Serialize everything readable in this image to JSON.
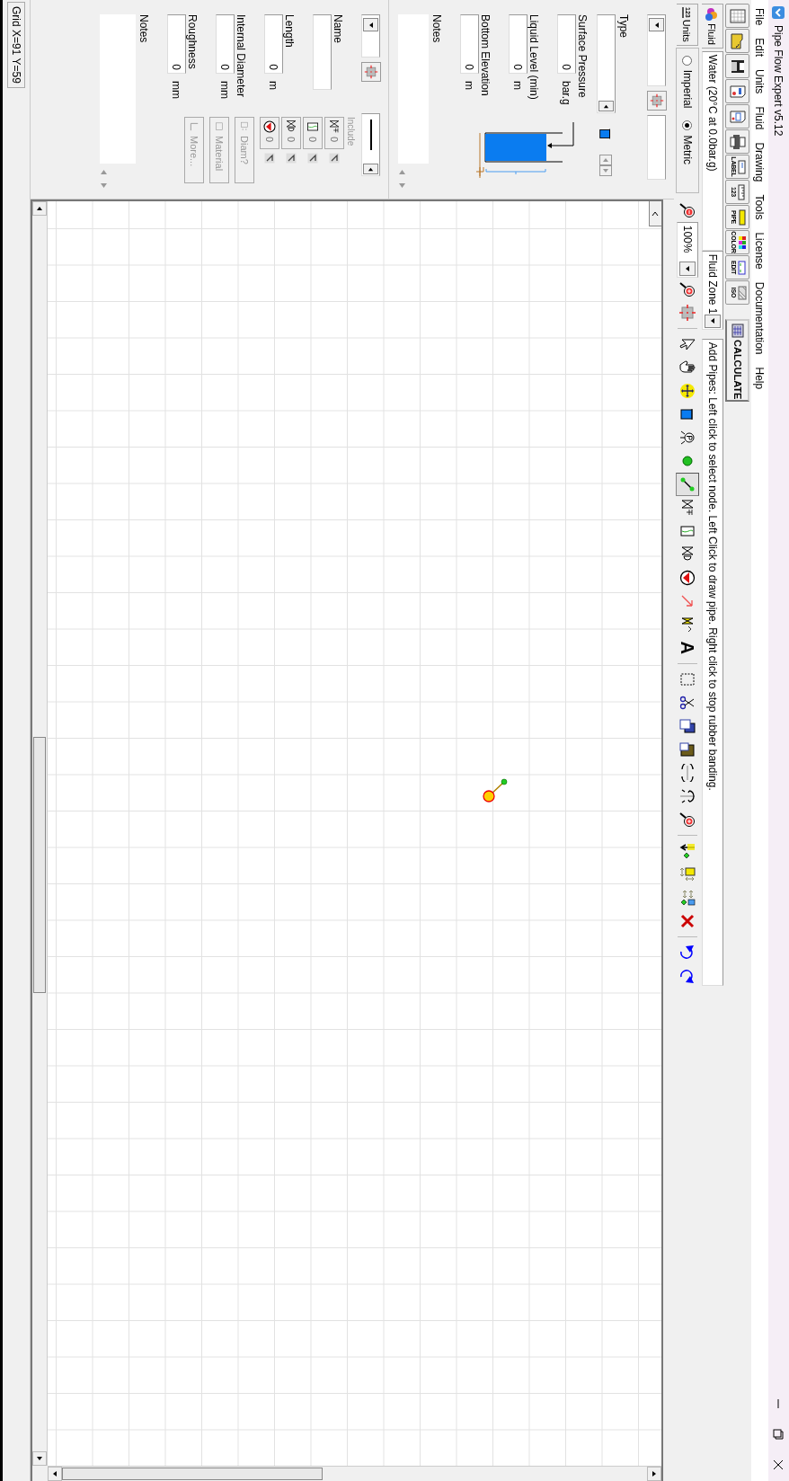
{
  "window": {
    "title": "Pipe Flow Expert v5.12"
  },
  "menu": [
    "File",
    "Edit",
    "Units",
    "Fluid",
    "Drawing",
    "Tools",
    "License",
    "Documentation",
    "Help"
  ],
  "file_toolbar": [
    {
      "kind": "new"
    },
    {
      "kind": "open"
    },
    {
      "kind": "save"
    },
    {
      "kind": "report"
    },
    {
      "kind": "preview"
    },
    {
      "kind": "print"
    },
    {
      "kind": "label",
      "label": "LABEL"
    },
    {
      "kind": "units",
      "label": "123"
    },
    {
      "kind": "pipe_db",
      "label": "PIPE"
    },
    {
      "kind": "color",
      "label": "COLOR"
    },
    {
      "kind": "edit",
      "label": "EDIT"
    },
    {
      "kind": "iso",
      "label": "ISO"
    }
  ],
  "calculate_button": "CALCULATE",
  "fluid": {
    "tab": "Fluid",
    "value": "Water (20°C at 0.0bar.g)"
  },
  "fluid_zone": {
    "value": "Fluid Zone 1"
  },
  "status_hint": "Add Pipes: Left click to select node. Left Click to draw pipe. Right click to stop rubber banding.",
  "units": {
    "tab_icon_text": "123",
    "tab": "Units",
    "options": [
      {
        "label": "Imperial",
        "selected": false
      },
      {
        "label": "Metric",
        "selected": true
      }
    ]
  },
  "zoom": {
    "value": "100%"
  },
  "tool_groups": [
    [
      {
        "kind": "pointer",
        "selected": false
      },
      {
        "kind": "hand",
        "selected": false
      },
      {
        "kind": "move",
        "selected": false
      },
      {
        "kind": "tank",
        "selected": false
      },
      {
        "kind": "gauge",
        "selected": false
      },
      {
        "kind": "node",
        "selected": false
      },
      {
        "kind": "pipe",
        "selected": true
      },
      {
        "kind": "valve",
        "selected": false
      },
      {
        "kind": "component",
        "selected": false
      },
      {
        "kind": "control_valve",
        "selected": false
      },
      {
        "kind": "pump",
        "selected": false
      },
      {
        "kind": "arrow_line",
        "selected": false
      },
      {
        "kind": "flow",
        "selected": false
      },
      {
        "kind": "text",
        "label": "A",
        "selected": false
      }
    ],
    [
      {
        "kind": "select"
      },
      {
        "kind": "cut"
      },
      {
        "kind": "copy"
      },
      {
        "kind": "paste"
      },
      {
        "kind": "flip_h"
      },
      {
        "kind": "flip_v"
      },
      {
        "kind": "zoom_area"
      }
    ],
    [
      {
        "kind": "insert_node"
      },
      {
        "kind": "resize"
      },
      {
        "kind": "shift"
      },
      {
        "kind": "delete"
      }
    ],
    [
      {
        "kind": "undo"
      },
      {
        "kind": "redo"
      }
    ]
  ],
  "node_panel": {
    "type_label": "Type",
    "fields": [
      {
        "label": "Surface Pressure",
        "value": "0",
        "unit": "bar.g"
      },
      {
        "label": "Liquid Level (min)",
        "value": "0",
        "unit": "m"
      },
      {
        "label": "Bottom Elevation",
        "value": "0",
        "unit": "m"
      }
    ],
    "notes_label": "Notes"
  },
  "pipe_panel": {
    "name_label": "Name",
    "include_label": "Include",
    "fields": [
      {
        "label": "Length",
        "value": "0",
        "unit": "m"
      },
      {
        "label": "Internal Diameter",
        "value": "0",
        "unit": "mm"
      },
      {
        "label": "Roughness",
        "value": "0",
        "unit": "mm"
      }
    ],
    "fittings": [
      {
        "kind": "valve",
        "count": "0"
      },
      {
        "kind": "component",
        "count": "0"
      },
      {
        "kind": "control_valve",
        "count": "0"
      },
      {
        "kind": "pump",
        "count": "0"
      }
    ],
    "buttons": [
      {
        "kind": "diameter",
        "label": "Diam?",
        "disabled": true
      },
      {
        "kind": "material",
        "label": "Material",
        "disabled": true
      },
      {
        "kind": "more",
        "label": "More...",
        "disabled": true
      }
    ],
    "notes_label": "Notes"
  },
  "status_bar": {
    "text": "Grid X=91 Y=59"
  }
}
